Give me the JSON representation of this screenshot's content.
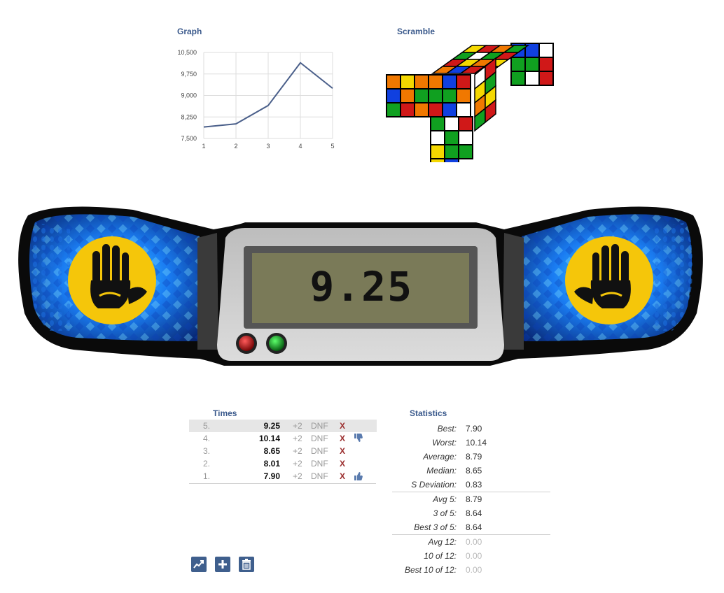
{
  "graph": {
    "title": "Graph",
    "chart_data": {
      "type": "line",
      "x": [
        1,
        2,
        3,
        4,
        5
      ],
      "y": [
        7.9,
        8.01,
        8.65,
        10.14,
        9.25
      ],
      "yticks": [
        "10,500",
        "9,750",
        "9,000",
        "8,250",
        "7,500"
      ],
      "xticks": [
        "1",
        "2",
        "3",
        "4",
        "5"
      ],
      "ylim": [
        7.5,
        10.5
      ],
      "grid": true,
      "color": "#4a5f8a"
    }
  },
  "scramble": {
    "title": "Scramble"
  },
  "timer": {
    "display": "9.25",
    "left_button_color": "#8b1010",
    "right_button_color": "#0d7a1a"
  },
  "times": {
    "title": "Times",
    "plus2_label": "+2",
    "dnf_label": "DNF",
    "delete_label": "X",
    "rows": [
      {
        "num": "5.",
        "time": "9.25",
        "thumb": "",
        "selected": true
      },
      {
        "num": "4.",
        "time": "10.14",
        "thumb": "down",
        "selected": false
      },
      {
        "num": "3.",
        "time": "8.65",
        "thumb": "",
        "selected": false
      },
      {
        "num": "2.",
        "time": "8.01",
        "thumb": "",
        "selected": false
      },
      {
        "num": "1.",
        "time": "7.90",
        "thumb": "up",
        "selected": false
      }
    ],
    "toolbar": [
      "chart-icon",
      "add-icon",
      "trash-icon"
    ]
  },
  "statistics": {
    "title": "Statistics",
    "group1": [
      {
        "label": "Best:",
        "value": "7.90"
      },
      {
        "label": "Worst:",
        "value": "10.14"
      },
      {
        "label": "Average:",
        "value": "8.79"
      },
      {
        "label": "Median:",
        "value": "8.65"
      },
      {
        "label": "S Deviation:",
        "value": "0.83"
      }
    ],
    "group2": [
      {
        "label": "Avg 5:",
        "value": "8.79"
      },
      {
        "label": "3 of 5:",
        "value": "8.64"
      },
      {
        "label": "Best 3 of 5:",
        "value": "8.64"
      }
    ],
    "group3": [
      {
        "label": "Avg 12:",
        "value": "0.00"
      },
      {
        "label": "10 of 12:",
        "value": "0.00"
      },
      {
        "label": "Best 10 of 12:",
        "value": "0.00"
      }
    ]
  }
}
